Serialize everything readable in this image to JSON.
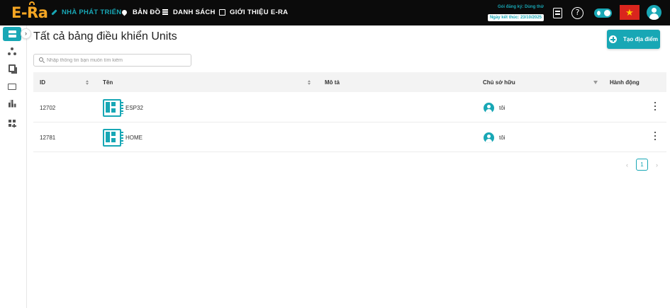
{
  "brand": {
    "logo_text": "E-Ra",
    "accent_color": "#18a7b5",
    "logo_color": "#f5a623"
  },
  "topnav": {
    "items": [
      {
        "label": "NHÀ PHÁT TRIỂN",
        "icon": "wrench-icon",
        "active": true
      },
      {
        "label": "BẢN ĐỒ",
        "icon": "map-pin-icon",
        "active": false
      },
      {
        "label": "DANH SÁCH",
        "icon": "list-icon",
        "active": false
      },
      {
        "label": "GIỚI THIỆU E-RA",
        "icon": "info-icon",
        "active": false
      }
    ],
    "plan_label": "Gói đăng ký: Dùng thử",
    "plan_end": "Ngày kết thúc: 23/10/2025",
    "flag": "★"
  },
  "sidebar": {
    "items": [
      {
        "icon": "dashboard-icon",
        "active": true
      },
      {
        "icon": "share-icon",
        "active": false
      },
      {
        "icon": "copy-icon",
        "active": false
      },
      {
        "icon": "device-icon",
        "active": false
      },
      {
        "icon": "chart-icon",
        "active": false
      },
      {
        "icon": "widgets-icon",
        "active": false
      }
    ],
    "expand_glyph": "›"
  },
  "page": {
    "title": "Tất cả bảng điều khiển Units",
    "create_button": "Tạo địa điểm",
    "search_placeholder": "Nhập thông tin bạn muốn tìm kiếm"
  },
  "table": {
    "columns": {
      "id": "ID",
      "name": "Tên",
      "description": "Mô tả",
      "owner": "Chủ sở hữu",
      "actions": "Hành động"
    },
    "rows": [
      {
        "id": "12702",
        "name": "ESP32",
        "description": "",
        "owner": "tôi"
      },
      {
        "id": "12781",
        "name": "HOME",
        "description": "",
        "owner": "tôi"
      }
    ]
  },
  "pagination": {
    "prev": "‹",
    "current": "1",
    "next": "›"
  }
}
